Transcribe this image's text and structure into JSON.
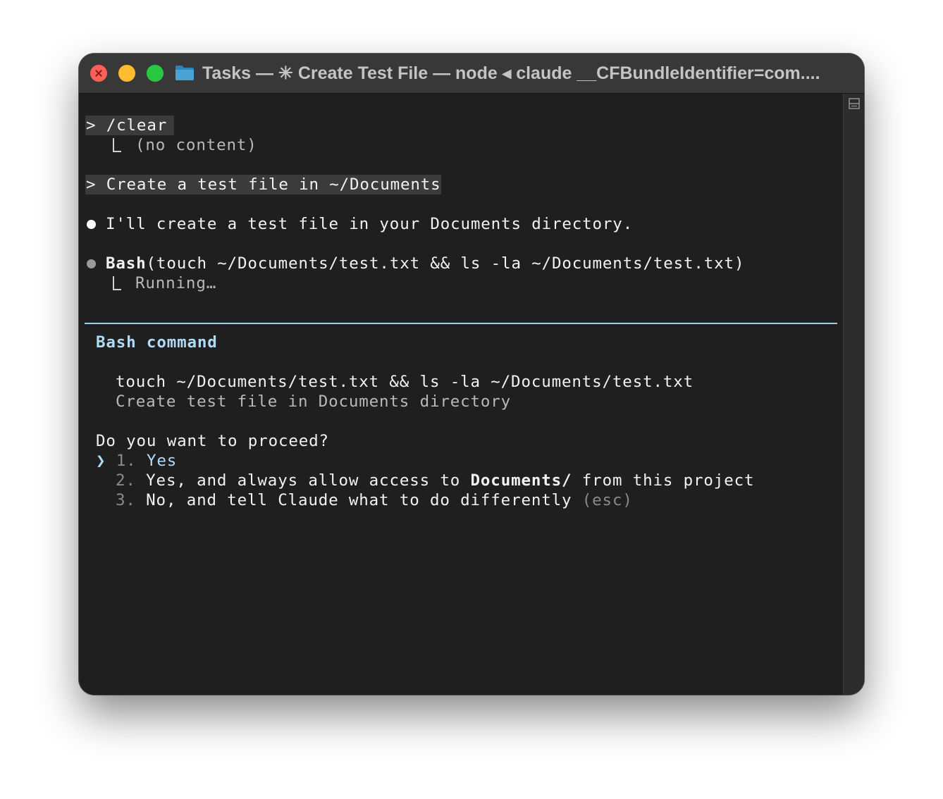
{
  "window": {
    "title": "Tasks — ✳ Create Test File — node ◂ claude __CFBundleIdentifier=com....",
    "folder_icon": "folder-icon",
    "colors": {
      "background": "#1f1f1f",
      "titlebar": "#383838",
      "accent": "#aedcf7"
    }
  },
  "transcript": {
    "clear_prompt": "> /clear ",
    "clear_output": "(no content)",
    "user_prompt": "> Create a test file in ~/Documents ",
    "assistant_message": "I'll create a test file in your Documents directory.",
    "tool_name": "Bash",
    "tool_args": "(touch ~/Documents/test.txt && ls -la ~/Documents/test.txt)",
    "tool_status": "Running…"
  },
  "permission": {
    "heading": "Bash command",
    "command": "touch ~/Documents/test.txt && ls -la ~/Documents/test.txt",
    "description": "Create test file in Documents directory",
    "question": "Do you want to proceed?",
    "cursor": "❯",
    "options": [
      {
        "number": "1.",
        "label": "Yes"
      },
      {
        "number": "2.",
        "label_before": "Yes, and always allow access to ",
        "label_bold": "Documents/",
        "label_after": " from this project"
      },
      {
        "number": "3.",
        "label": "No, and tell Claude what to do differently",
        "hint": "(esc)"
      }
    ]
  }
}
